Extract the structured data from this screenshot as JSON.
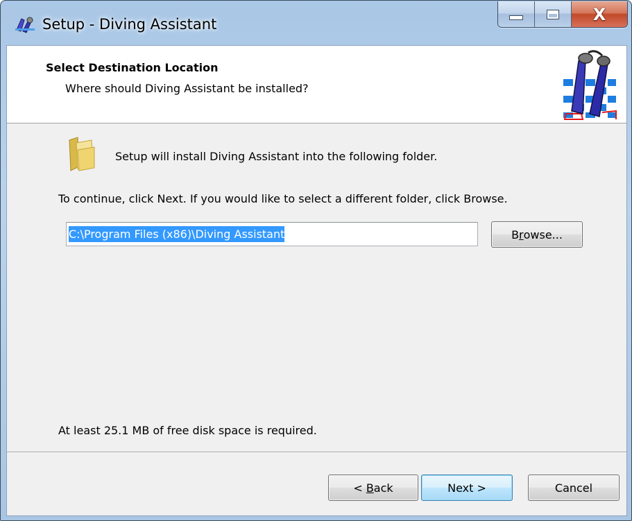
{
  "window": {
    "title": "Setup - Diving Assistant",
    "controls": {
      "minimize": "minimize",
      "maximize": "maximize",
      "close": "X"
    }
  },
  "header": {
    "title": "Select Destination Location",
    "subtitle": "Where should Diving Assistant be installed?"
  },
  "body": {
    "intro": "Setup will install Diving Assistant into the following folder.",
    "instruction": "To continue, click Next. If you would like to select a different folder, click Browse.",
    "path_value": "C:\\Program Files (x86)\\Diving Assistant",
    "browse_pre": "B",
    "browse_accel": "r",
    "browse_post": "owse...",
    "space_required": "At least 25.1 MB of free disk space is required."
  },
  "footer": {
    "back_pre": "< ",
    "back_accel": "B",
    "back_post": "ack",
    "next_label": "Next >",
    "cancel_label": "Cancel"
  },
  "icons": {
    "app": "diving-fins-icon",
    "header_logo": "diving-fins-logo",
    "folder": "folder-icon"
  },
  "colors": {
    "selection": "#3399ff",
    "close_button": "#c8553a",
    "frame": "#a9c7e6"
  }
}
